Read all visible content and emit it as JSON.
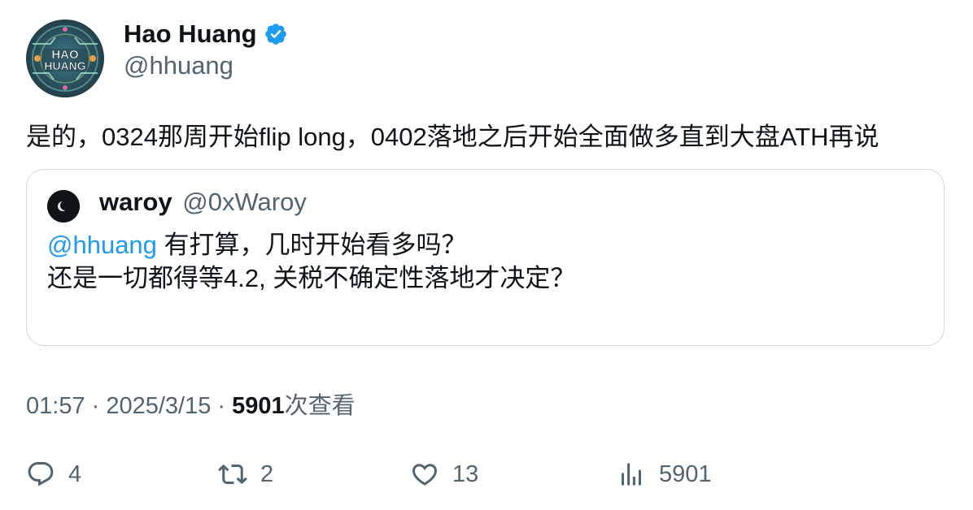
{
  "author": {
    "name": "Hao Huang",
    "handle": "@hhuang",
    "avatar_text_line1": "HAO",
    "avatar_text_line2": "HUANG",
    "verified_icon": "verified-badge-icon",
    "verified_color": "#1d9bf0"
  },
  "tweet": {
    "text": "是的，0324那周开始flip long，0402落地之后开始全面做多直到大盘ATH再说"
  },
  "quote": {
    "name": "waroy",
    "handle": "@0xWaroy",
    "mention": "@hhuang",
    "line1_rest": " 有打算，几时开始看多吗？",
    "line2": "还是一切都得等4.2, 关税不确定性落地才决定？"
  },
  "meta": {
    "time": "01:57",
    "sep1": " · ",
    "date": "2025/3/15",
    "sep2": " · ",
    "views": "5901",
    "views_suffix": "次查看"
  },
  "actions": {
    "reply_count": "4",
    "retweet_count": "2",
    "like_count": "13",
    "views_count": "5901"
  },
  "colors": {
    "text": "#0f1419",
    "secondary": "#536471",
    "accent": "#1d9bf0",
    "border": "#cfd9de"
  }
}
